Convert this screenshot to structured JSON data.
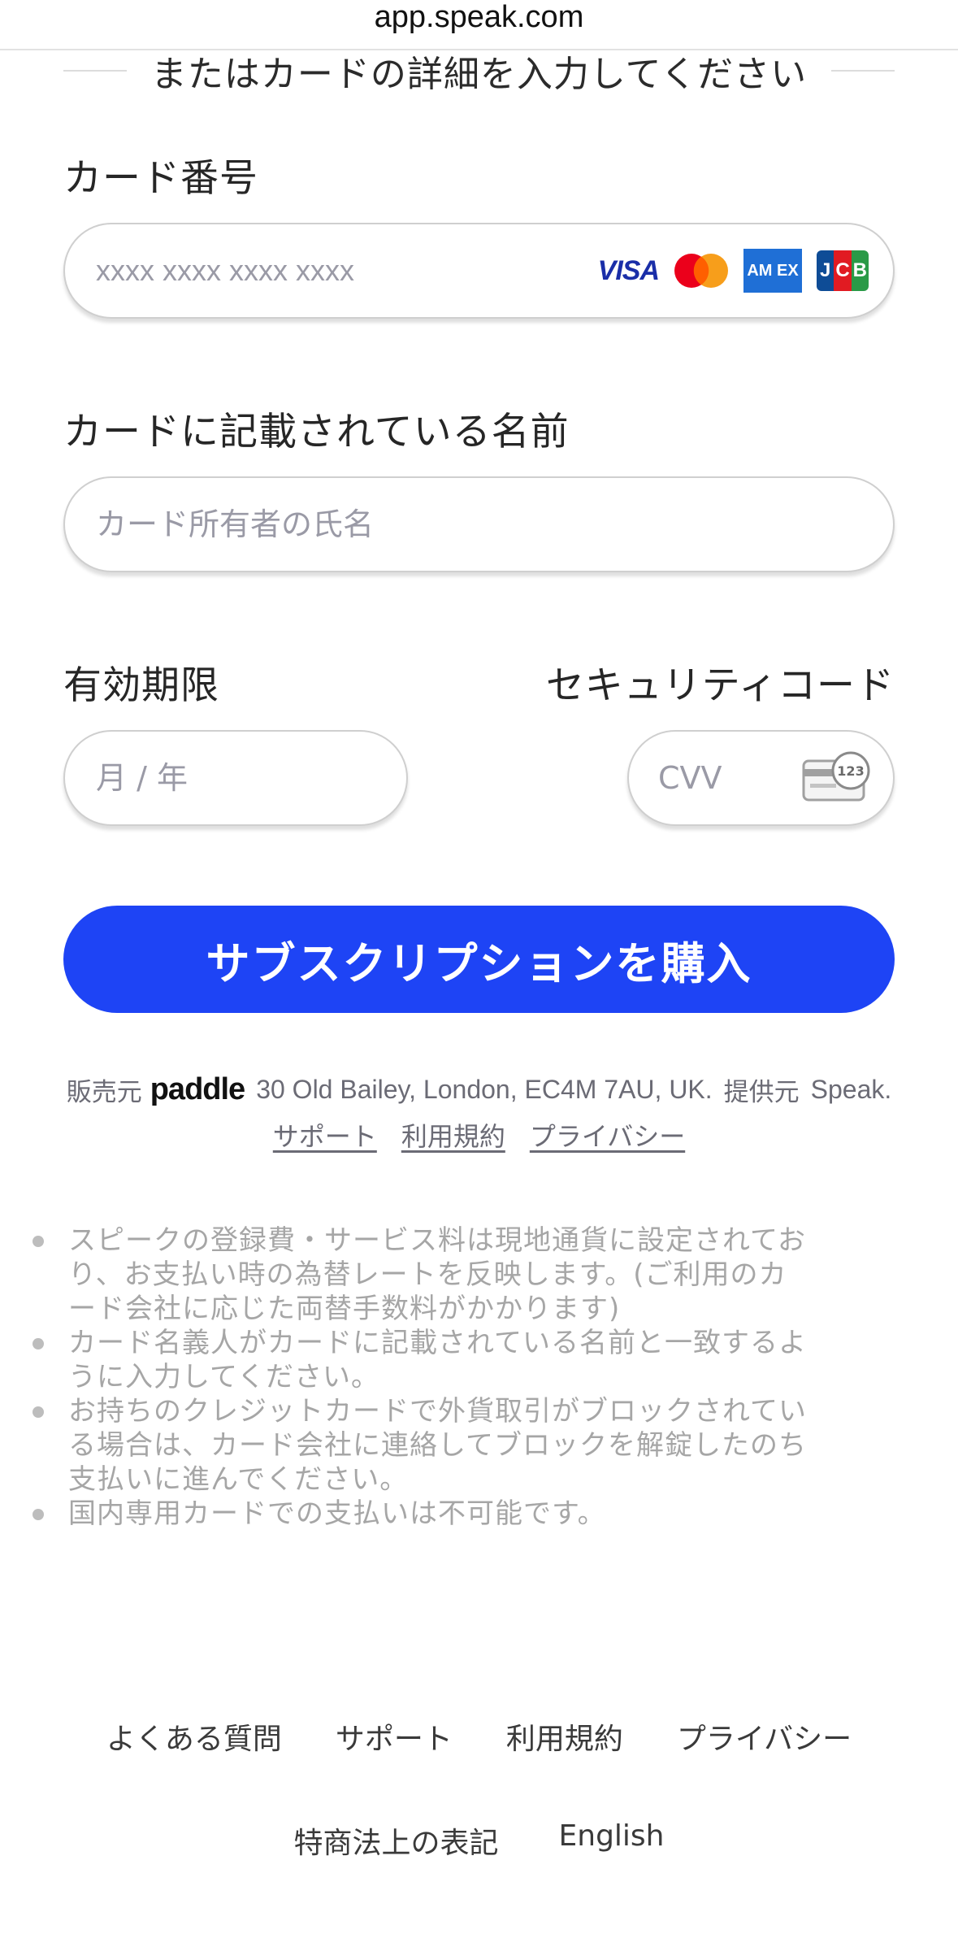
{
  "browser": {
    "url": "app.speak.com"
  },
  "divider": {
    "text": "またはカードの詳細を入力してください"
  },
  "card_number": {
    "label": "カード番号",
    "placeholder": "xxxx xxxx xxxx xxxx",
    "brands": {
      "visa": "VISA",
      "amex": "AM EX",
      "jcb": [
        "J",
        "C",
        "B"
      ]
    }
  },
  "card_name": {
    "label": "カードに記載されている名前",
    "placeholder": "カード所有者の氏名"
  },
  "expiry": {
    "label": "有効期限",
    "placeholder": "月 / 年"
  },
  "security_code": {
    "label": "セキュリティコード",
    "placeholder": "CVV",
    "icon_digits": "123"
  },
  "buy_button": {
    "label": "サブスクリプションを購入"
  },
  "seller": {
    "sold_by": "販売元",
    "paddle_logo": "paddle",
    "address": "30 Old Bailey, London, EC4M 7AU, UK.",
    "provided_by": "提供元",
    "provider": "Speak.",
    "links": [
      "サポート",
      "利用規約",
      "プライバシー"
    ]
  },
  "notes": [
    "スピークの登録費・サービス料は現地通貨に設定されており、お支払い時の為替レートを反映します。(ご利用のカード会社に応じた両替手数料がかかります)",
    "カード名義人がカードに記載されている名前と一致するように入力してください。",
    "お持ちのクレジットカードで外貨取引がブロックされている場合は、カード会社に連絡してブロックを解錠したのち支払いに進んでください。",
    "国内専用カードでの支払いは不可能です。"
  ],
  "footer": {
    "row1": [
      "よくある質問",
      "サポート",
      "利用規約",
      "プライバシー"
    ],
    "row2": [
      "特商法上の表記",
      "English"
    ]
  },
  "colors": {
    "primary_button": "#1e44f5",
    "placeholder": "#9a9aa6",
    "muted_text": "#a6a6a6"
  }
}
